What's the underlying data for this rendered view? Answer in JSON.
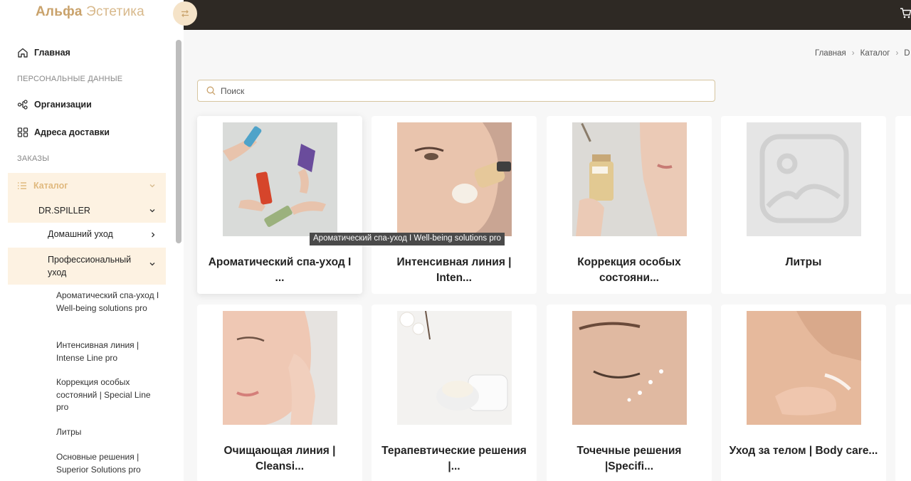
{
  "brand": {
    "bold": "Альфа",
    "light": "Эстетика"
  },
  "sidebar": {
    "home": "Главная",
    "section_personal": "ПЕРСОНАЛЬНЫЕ ДАННЫЕ",
    "organizations": "Организации",
    "addresses": "Адреса доставки",
    "section_orders": "ЗАКАЗЫ",
    "catalog": "Каталог",
    "brand_group": "DR.SPILLER",
    "home_care": "Домашний уход",
    "professional": "Профессиональный уход",
    "sub_items": [
      "Ароматический спа-уход I Well-being solutions pro",
      "Интенсивная линия | Intense Line pro",
      "Коррекция особых состояний | Special Line pro",
      "Литры",
      "Основные решения | Superior Solutions pro"
    ]
  },
  "breadcrumb": {
    "items": [
      "Главная",
      "Каталог",
      "D"
    ]
  },
  "search": {
    "placeholder": "Поиск",
    "value": ""
  },
  "tooltip": "Ароматический спа-уход I Well-being solutions pro",
  "products": [
    {
      "title": "Ароматический спа-уход I ...",
      "image": "hands-with-cosmetic-tubes"
    },
    {
      "title": "Интенсивная линия | Inten...",
      "image": "face-with-brush-cream"
    },
    {
      "title": "Коррекция особых состояни...",
      "image": "face-with-serum-bottle"
    },
    {
      "title": "Литры",
      "image": "image-placeholder-icon"
    },
    {
      "title": "Очищающая линия | Cleansi...",
      "image": "woman-touching-face"
    },
    {
      "title": "Терапевтические решения |...",
      "image": "cream-jar-with-cotton"
    },
    {
      "title": "Точечные решения |Specifi...",
      "image": "eye-with-cream-dots"
    },
    {
      "title": "Уход за телом | Body care...",
      "image": "neck-shoulder-care"
    }
  ],
  "colors": {
    "accent": "#c9a26b",
    "active_bg": "#fdf2e2",
    "topbar": "#2e2924"
  }
}
